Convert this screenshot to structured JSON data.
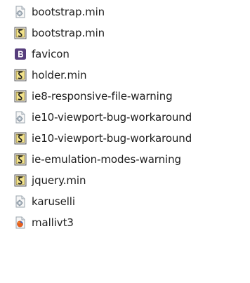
{
  "files": [
    {
      "name": "bootstrap.min",
      "icon": "gear-file-icon"
    },
    {
      "name": "bootstrap.min",
      "icon": "script-file-icon"
    },
    {
      "name": "favicon",
      "icon": "bootstrap-logo-icon"
    },
    {
      "name": "holder.min",
      "icon": "script-file-icon"
    },
    {
      "name": "ie8-responsive-file-warning",
      "icon": "script-file-icon"
    },
    {
      "name": "ie10-viewport-bug-workaround",
      "icon": "gear-file-icon"
    },
    {
      "name": "ie10-viewport-bug-workaround",
      "icon": "script-file-icon"
    },
    {
      "name": "ie-emulation-modes-warning",
      "icon": "script-file-icon"
    },
    {
      "name": "jquery.min",
      "icon": "script-file-icon"
    },
    {
      "name": "karuselli",
      "icon": "gear-file-icon"
    },
    {
      "name": "mallivt3",
      "icon": "firefox-html-icon"
    }
  ],
  "colors": {
    "bootstrap_purple": "#563d7c",
    "script_yellow": "#f2e28a",
    "firefox_orange": "#e8601c"
  }
}
